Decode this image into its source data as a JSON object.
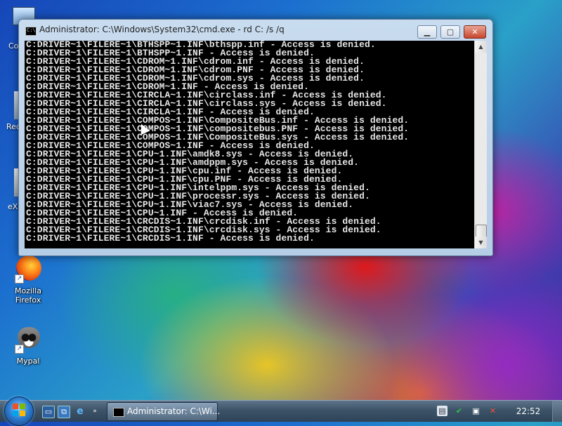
{
  "desktop": {
    "icons": [
      {
        "label": "Mozilla Firefox",
        "icon": "firefox-icon"
      },
      {
        "label": "Mypal",
        "icon": "raccoon-icon"
      }
    ],
    "partial_labels": [
      "Co",
      "Rec",
      "eX"
    ]
  },
  "window": {
    "title": "Administrator: C:\\Windows\\System32\\cmd.exe - rd  C: /s /q",
    "minimize_label": "▁",
    "maximize_label": "▢",
    "close_label": "✕",
    "console_lines": [
      "C:DRIVER~1\\FILERE~1\\BTHSPP~1.INF\\bthspp.inf - Access is denied.",
      "C:DRIVER~1\\FILERE~1\\BTHSPP~1.INF - Access is denied.",
      "C:DRIVER~1\\FILERE~1\\CDROM~1.INF\\cdrom.inf - Access is denied.",
      "C:DRIVER~1\\FILERE~1\\CDROM~1.INF\\cdrom.PNF - Access is denied.",
      "C:DRIVER~1\\FILERE~1\\CDROM~1.INF\\cdrom.sys - Access is denied.",
      "C:DRIVER~1\\FILERE~1\\CDROM~1.INF - Access is denied.",
      "C:DRIVER~1\\FILERE~1\\CIRCLA~1.INF\\circlass.inf - Access is denied.",
      "C:DRIVER~1\\FILERE~1\\CIRCLA~1.INF\\circlass.sys - Access is denied.",
      "C:DRIVER~1\\FILERE~1\\CIRCLA~1.INF - Access is denied.",
      "C:DRIVER~1\\FILERE~1\\COMPOS~1.INF\\CompositeBus.inf - Access is denied.",
      "C:DRIVER~1\\FILERE~1\\COMPOS~1.INF\\compositebus.PNF - Access is denied.",
      "C:DRIVER~1\\FILERE~1\\COMPOS~1.INF\\CompositeBus.sys - Access is denied.",
      "C:DRIVER~1\\FILERE~1\\COMPOS~1.INF - Access is denied.",
      "C:DRIVER~1\\FILERE~1\\CPU~1.INF\\amdk8.sys - Access is denied.",
      "C:DRIVER~1\\FILERE~1\\CPU~1.INF\\amdppm.sys - Access is denied.",
      "C:DRIVER~1\\FILERE~1\\CPU~1.INF\\cpu.inf - Access is denied.",
      "C:DRIVER~1\\FILERE~1\\CPU~1.INF\\cpu.PNF - Access is denied.",
      "C:DRIVER~1\\FILERE~1\\CPU~1.INF\\intelppm.sys - Access is denied.",
      "C:DRIVER~1\\FILERE~1\\CPU~1.INF\\processr.sys - Access is denied.",
      "C:DRIVER~1\\FILERE~1\\CPU~1.INF\\viac7.sys - Access is denied.",
      "C:DRIVER~1\\FILERE~1\\CPU~1.INF - Access is denied.",
      "C:DRIVER~1\\FILERE~1\\CRCDIS~1.INF\\crcdisk.inf - Access is denied.",
      "C:DRIVER~1\\FILERE~1\\CRCDIS~1.INF\\crcdisk.sys - Access is denied.",
      "C:DRIVER~1\\FILERE~1\\CRCDIS~1.INF - Access is denied."
    ]
  },
  "taskbar": {
    "active_task_label": "Administrator: C:\\Wi...",
    "clock": "22:52",
    "quick_launch": [
      "show-desktop-icon",
      "switch-windows-icon",
      "internet-explorer-icon"
    ],
    "tray_icons": [
      "network-icon",
      "security-shield-icon",
      "speaker-muted-icon",
      "power-icon"
    ]
  }
}
